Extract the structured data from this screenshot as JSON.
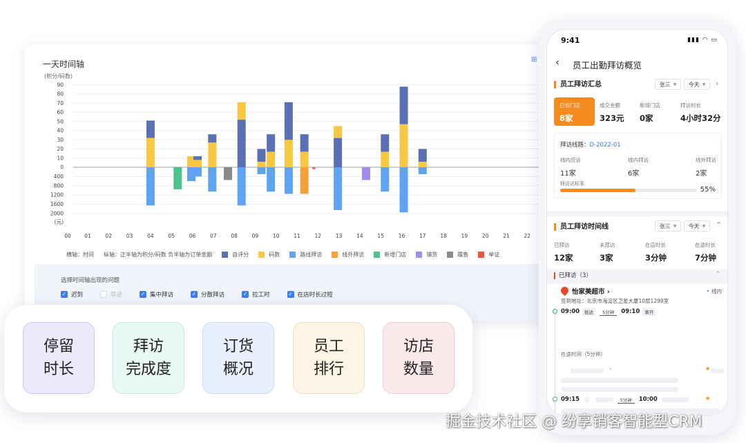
{
  "timeline_card": {
    "title": "一天时间轴",
    "unit": "(积分/码数)",
    "legend": {
      "x_axis_text": "横轴：时间",
      "y_axis_text": "纵轴：正半轴为积分/码数  负半轴为订单金额",
      "items": [
        {
          "label": "自评分",
          "color": "#5b6fb3"
        },
        {
          "label": "码数",
          "color": "#f7c842"
        },
        {
          "label": "路线拜访",
          "color": "#5ea4f3"
        },
        {
          "label": "线外拜访",
          "color": "#f3a13a"
        },
        {
          "label": "新增门店",
          "color": "#4cc38a"
        },
        {
          "label": "铺货",
          "color": "#a58bea"
        },
        {
          "label": "履售",
          "color": "#8a8a8a"
        },
        {
          "label": "举证",
          "color": "#e8573f"
        }
      ]
    },
    "filter": {
      "title": "选择时间轴出现的问题",
      "options": [
        {
          "label": "迟到",
          "checked": true
        },
        {
          "label": "早退",
          "checked": false
        },
        {
          "label": "集中拜访",
          "checked": true
        },
        {
          "label": "分散拜访",
          "checked": true
        },
        {
          "label": "拉工时",
          "checked": true
        },
        {
          "label": "在店时长过短",
          "checked": true
        }
      ]
    }
  },
  "chart_data": {
    "type": "bar",
    "stacked": true,
    "x_ticks": [
      "00",
      "01",
      "02",
      "03",
      "04",
      "05",
      "06",
      "07",
      "08",
      "09",
      "10",
      "11",
      "12",
      "13",
      "14",
      "15",
      "16",
      "17",
      "18",
      "19",
      "20",
      "21",
      "22"
    ],
    "y_ticks_positive": [
      "90",
      "80",
      "70",
      "60",
      "50",
      "40",
      "30",
      "20",
      "10",
      "0"
    ],
    "y_ticks_negative": [
      "400",
      "800",
      "1200",
      "1600",
      "2000"
    ],
    "y_negative_unit": "(元)",
    "bars": [
      {
        "x": 4.0,
        "pos": [
          {
            "s": "码数",
            "v": 32
          },
          {
            "s": "自评分",
            "v": 19
          }
        ],
        "neg": [
          {
            "s": "路线拜访",
            "v": 1650
          }
        ]
      },
      {
        "x": 5.3,
        "pos": [],
        "neg": [
          {
            "s": "新增门店",
            "v": 950
          }
        ]
      },
      {
        "x": 5.95,
        "pos": [
          {
            "s": "码数",
            "v": 12
          }
        ],
        "neg": [
          {
            "s": "路线拜访",
            "v": 600
          }
        ]
      },
      {
        "x": 6.25,
        "pos": [
          {
            "s": "码数",
            "v": 8
          },
          {
            "s": "自评分",
            "v": 4
          }
        ],
        "neg": [
          {
            "s": "路线拜访",
            "v": 400
          }
        ]
      },
      {
        "x": 6.95,
        "pos": [
          {
            "s": "码数",
            "v": 27
          },
          {
            "s": "自评分",
            "v": 9
          }
        ],
        "neg": [
          {
            "s": "路线拜访",
            "v": 1050
          }
        ]
      },
      {
        "x": 7.7,
        "pos": [],
        "neg": [
          {
            "s": "履售",
            "v": 550
          }
        ]
      },
      {
        "x": 8.35,
        "pos": [
          {
            "s": "自评分",
            "v": 52
          },
          {
            "s": "码数",
            "v": 19
          }
        ],
        "neg": [
          {
            "s": "路线拜访",
            "v": 1650
          }
        ]
      },
      {
        "x": 9.3,
        "pos": [
          {
            "s": "码数",
            "v": 6
          },
          {
            "s": "自评分",
            "v": 14
          }
        ],
        "neg": [
          {
            "s": "路线拜访",
            "v": 300
          }
        ]
      },
      {
        "x": 9.75,
        "pos": [
          {
            "s": "码数",
            "v": 17
          },
          {
            "s": "自评分",
            "v": 19
          }
        ],
        "neg": [
          {
            "s": "路线拜访",
            "v": 1050
          }
        ]
      },
      {
        "x": 10.6,
        "pos": [
          {
            "s": "码数",
            "v": 30
          },
          {
            "s": "自评分",
            "v": 41
          }
        ],
        "neg": [
          {
            "s": "路线拜访",
            "v": 1150
          }
        ]
      },
      {
        "x": 11.35,
        "pos": [
          {
            "s": "码数",
            "v": 17
          },
          {
            "s": "自评分",
            "v": 19
          }
        ],
        "neg": [
          {
            "s": "线外拜访",
            "v": 1150
          }
        ]
      },
      {
        "x": 11.8,
        "pos": [],
        "neg": [
          {
            "s": "举证",
            "v": 80
          }
        ]
      },
      {
        "x": 12.95,
        "pos": [
          {
            "s": "自评分",
            "v": 32
          },
          {
            "s": "码数",
            "v": 13
          }
        ],
        "neg": [
          {
            "s": "路线拜访",
            "v": 1850
          }
        ]
      },
      {
        "x": 14.3,
        "pos": [],
        "neg": [
          {
            "s": "铺货",
            "v": 550
          }
        ]
      },
      {
        "x": 15.2,
        "pos": [
          {
            "s": "码数",
            "v": 17
          },
          {
            "s": "自评分",
            "v": 19
          }
        ],
        "neg": [
          {
            "s": "路线拜访",
            "v": 1050
          }
        ]
      },
      {
        "x": 16.1,
        "pos": [
          {
            "s": "码数",
            "v": 47
          },
          {
            "s": "自评分",
            "v": 41
          }
        ],
        "neg": [
          {
            "s": "路线拜访",
            "v": 1950
          }
        ]
      },
      {
        "x": 17.0,
        "pos": [
          {
            "s": "码数",
            "v": 6
          },
          {
            "s": "自评分",
            "v": 14
          }
        ],
        "neg": [
          {
            "s": "路线拜访",
            "v": 300
          }
        ]
      }
    ]
  },
  "feature_tiles": [
    {
      "label": "停留\n时长"
    },
    {
      "label": "拜访\n完成度"
    },
    {
      "label": "订货\n概况"
    },
    {
      "label": "员工\n排行"
    },
    {
      "label": "访店\n数量"
    }
  ],
  "phone": {
    "status_time": "9:41",
    "status_icons": "▮▮▮ ◠ ▭",
    "nav_title": "员工出勤拜访概览",
    "summary": {
      "title": "员工拜访汇总",
      "employee": "张三",
      "date": "今天",
      "stats": [
        {
          "label": "已访门店",
          "value": "8家"
        },
        {
          "label": "成交金额",
          "value": "323元"
        },
        {
          "label": "新增门店",
          "value": "0家"
        },
        {
          "label": "拜访时长",
          "value": "4小时32分"
        }
      ],
      "route_label": "拜访线路：",
      "route_code": "D-2022-01",
      "route_stats": [
        {
          "label": "线内应访",
          "value": "11家"
        },
        {
          "label": "线内拜访",
          "value": "6家"
        },
        {
          "label": "线外拜访",
          "value": "2家"
        }
      ],
      "rate_label": "拜访达标率",
      "rate_value": "55%",
      "rate_fraction": 0.55
    },
    "timeline": {
      "title": "员工拜访时间线",
      "employee": "张三",
      "date": "今天",
      "stats": [
        {
          "label": "已拜访",
          "value": "12家"
        },
        {
          "label": "未拜访",
          "value": "3家"
        },
        {
          "label": "在店时长",
          "value": "3分钟"
        },
        {
          "label": "在途时长",
          "value": "7分钟"
        }
      ],
      "visited_label": "已拜访（3）",
      "store_name": "怡家美超市",
      "store_tag": "线内",
      "store_addr": "签到地址：北京市海淀区卫星大厦10层1299室",
      "visit1": {
        "start": "09:00",
        "start_tag": "抵达",
        "gap": "5分钟",
        "end": "09:10",
        "end_tag": "离开"
      },
      "on_road_label": "在途时间（5分钟）",
      "visit2": {
        "start": "09:15",
        "gap": "5分钟",
        "end": "10:00"
      }
    }
  },
  "watermark": "掘金技术社区 @ 纷享销客智能型CRM"
}
